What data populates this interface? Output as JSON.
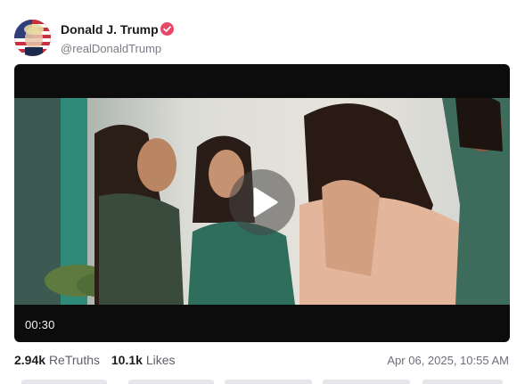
{
  "author": {
    "display_name": "Donald J. Trump",
    "handle": "@realDonaldTrump",
    "avatar_icon": "flag-portrait-avatar",
    "verified_icon": "verified-badge-icon",
    "verified_color": "#e8476a"
  },
  "video": {
    "duration": "00:30",
    "play_icon": "play-icon"
  },
  "stats": {
    "retruths_count": "2.94k",
    "retruths_label": "ReTruths",
    "likes_count": "10.1k",
    "likes_label": "Likes"
  },
  "timestamp": "Apr 06, 2025, 10:55 AM",
  "colors": {
    "accent": "#e8476a",
    "video_bg": "#0c0c0c",
    "muted_text": "#7c7c86"
  }
}
